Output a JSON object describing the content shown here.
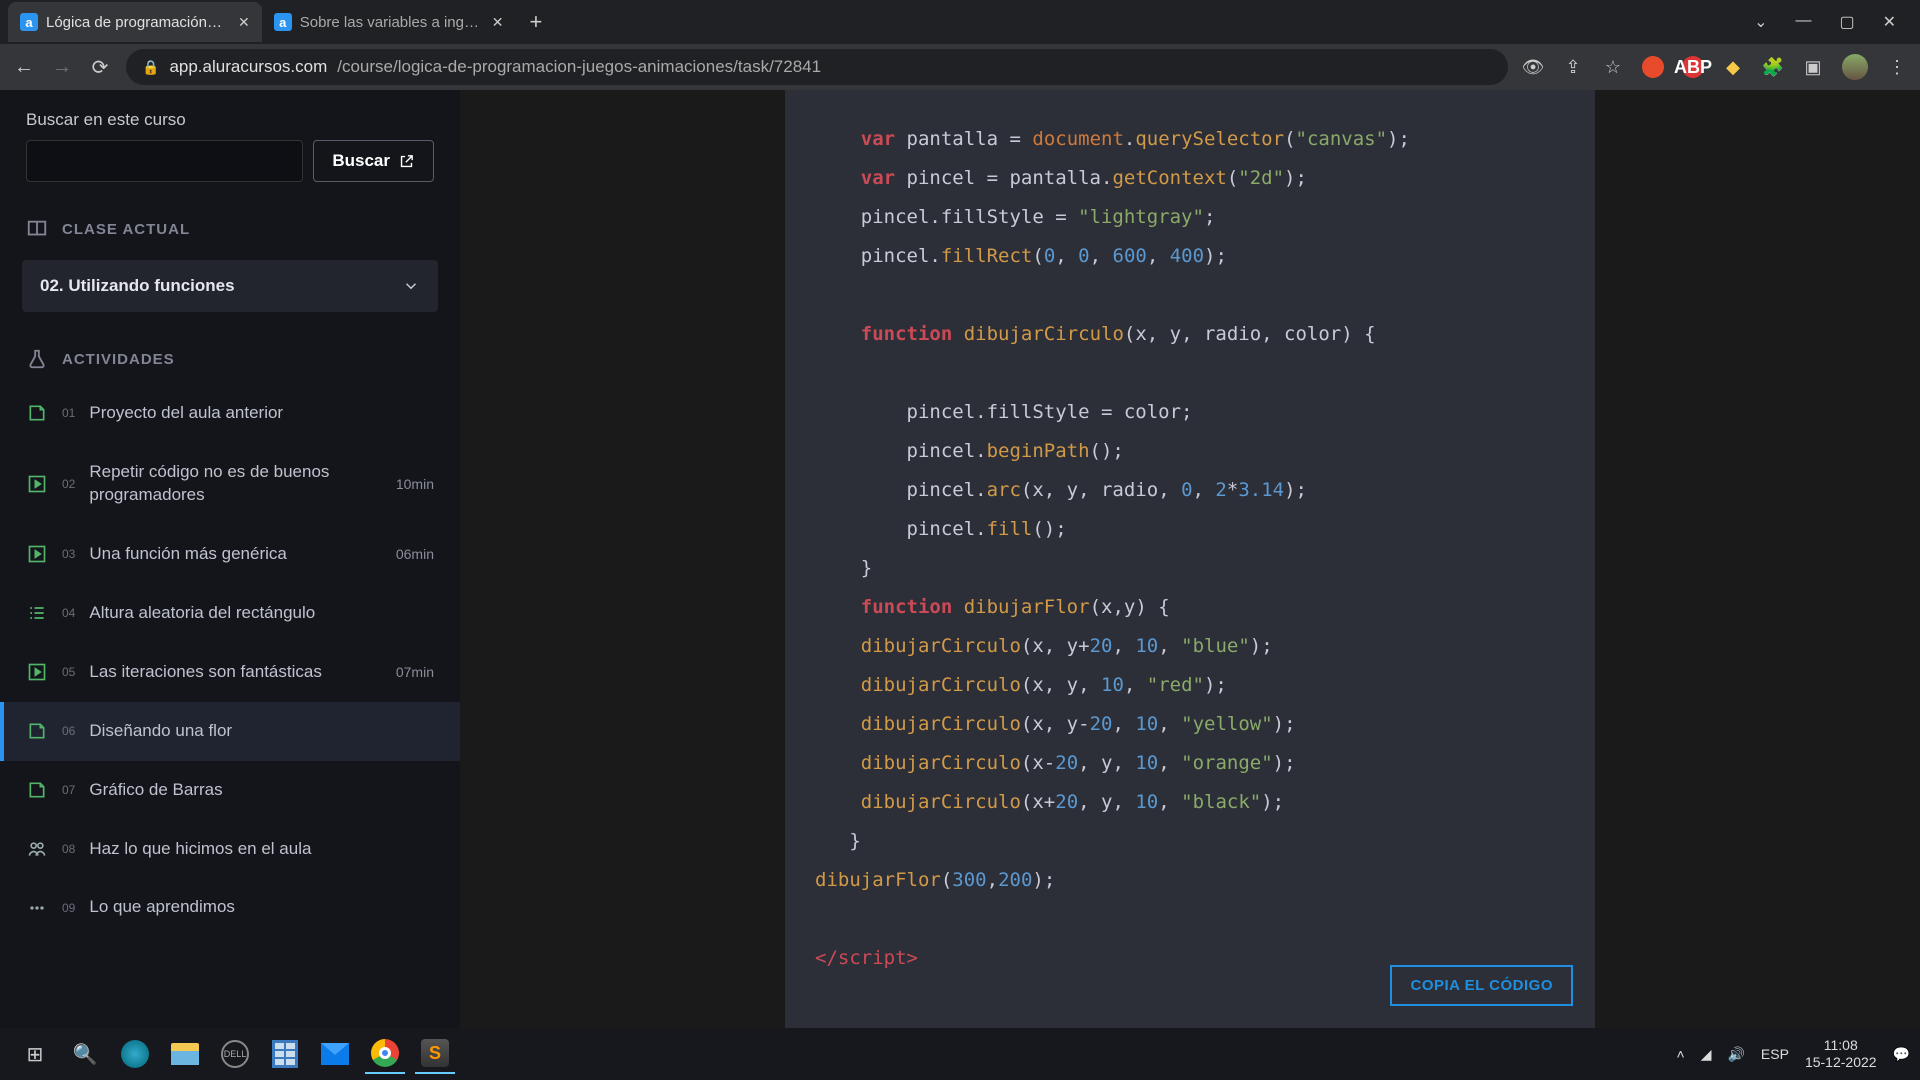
{
  "browser": {
    "tabs": [
      {
        "fav": "a",
        "title": "Lógica de programación: Practica",
        "active": true
      },
      {
        "fav": "a",
        "title": "Sobre las variables a ingresar par",
        "active": false
      }
    ],
    "url_host": "app.aluracursos.com",
    "url_path": "/course/logica-de-programacion-juegos-animaciones/task/72841"
  },
  "sidebar": {
    "search_label": "Buscar en este curso",
    "search_btn": "Buscar",
    "sec_class": "CLASE ACTUAL",
    "class_title": "02. Utilizando funciones",
    "sec_acts": "ACTIVIDADES",
    "items": [
      {
        "icon": "doc",
        "num": "01",
        "label": "Proyecto del aula anterior",
        "dur": ""
      },
      {
        "icon": "play",
        "num": "02",
        "label": "Repetir código no es de buenos programadores",
        "dur": "10min"
      },
      {
        "icon": "play",
        "num": "03",
        "label": "Una función más genérica",
        "dur": "06min"
      },
      {
        "icon": "list",
        "num": "04",
        "label": "Altura aleatoria del rectángulo",
        "dur": ""
      },
      {
        "icon": "play",
        "num": "05",
        "label": "Las iteraciones son fantásticas",
        "dur": "07min"
      },
      {
        "icon": "doc",
        "num": "06",
        "label": "Diseñando una flor",
        "dur": "",
        "active": true
      },
      {
        "icon": "doc",
        "num": "07",
        "label": "Gráfico de Barras",
        "dur": ""
      },
      {
        "icon": "people",
        "num": "08",
        "label": "Haz lo que hicimos en el aula",
        "dur": ""
      },
      {
        "icon": "dots",
        "num": "09",
        "label": "Lo que aprendimos",
        "dur": ""
      }
    ]
  },
  "content": {
    "copy_btn": "COPIA EL CÓDIGO"
  },
  "taskbar": {
    "lang": "ESP",
    "time": "11:08",
    "date": "15-12-2022"
  }
}
